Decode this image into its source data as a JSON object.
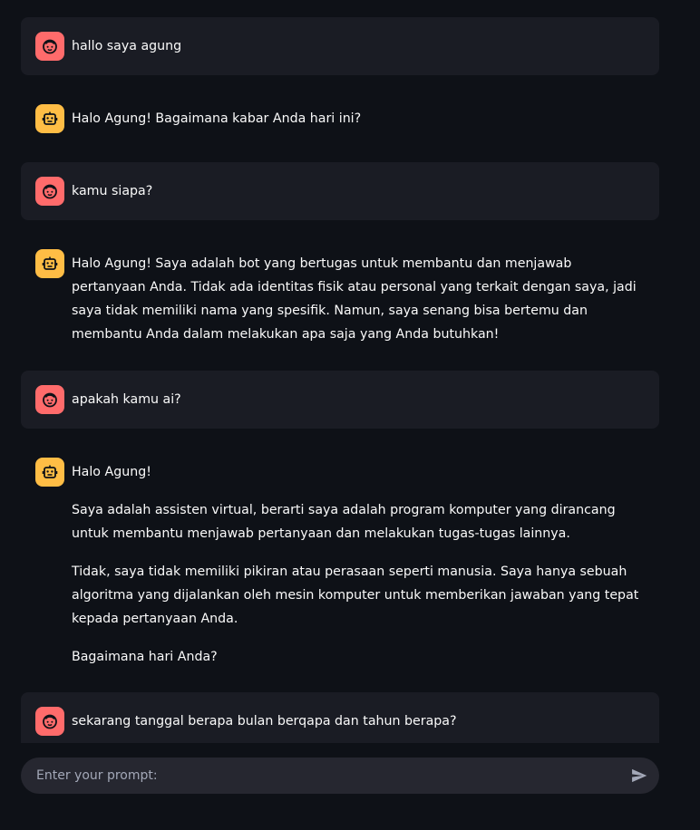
{
  "messages": [
    {
      "role": "user",
      "avatar_icon": "face-icon",
      "paragraphs": [
        "hallo saya agung"
      ]
    },
    {
      "role": "assistant",
      "avatar_icon": "robot-icon",
      "paragraphs": [
        "Halo Agung! Bagaimana kabar Anda hari ini?"
      ]
    },
    {
      "role": "user",
      "avatar_icon": "face-icon",
      "paragraphs": [
        "kamu siapa?"
      ]
    },
    {
      "role": "assistant",
      "avatar_icon": "robot-icon",
      "paragraphs": [
        "Halo Agung! Saya adalah bot yang bertugas untuk membantu dan menjawab pertanyaan Anda. Tidak ada identitas fisik atau personal yang terkait dengan saya, jadi saya tidak memiliki nama yang spesifik. Namun, saya senang bisa bertemu dan membantu Anda dalam melakukan apa saja yang Anda butuhkan!"
      ]
    },
    {
      "role": "user",
      "avatar_icon": "face-icon",
      "paragraphs": [
        "apakah kamu ai?"
      ]
    },
    {
      "role": "assistant",
      "avatar_icon": "robot-icon",
      "paragraphs": [
        "Halo Agung!",
        "Saya adalah assisten virtual, berarti saya adalah program komputer yang dirancang untuk membantu menjawab pertanyaan dan melakukan tugas-tugas lainnya.",
        "Tidak, saya tidak memiliki pikiran atau perasaan seperti manusia. Saya hanya sebuah algoritma yang dijalankan oleh mesin komputer untuk memberikan jawaban yang tepat kepada pertanyaan Anda.",
        "Bagaimana hari Anda?"
      ]
    },
    {
      "role": "user",
      "avatar_icon": "face-icon",
      "paragraphs": [
        "sekarang tanggal berapa bulan berqapa dan tahun berapa?"
      ]
    }
  ],
  "input": {
    "placeholder": "Enter your prompt:",
    "value": "",
    "send_icon": "send-icon"
  },
  "colors": {
    "background": "#0e1117",
    "user_bubble": "#1a1c24",
    "user_avatar": "#ff6b6b",
    "assistant_avatar": "#ffbd45",
    "input_bg": "#262730",
    "text": "#fafafa"
  }
}
